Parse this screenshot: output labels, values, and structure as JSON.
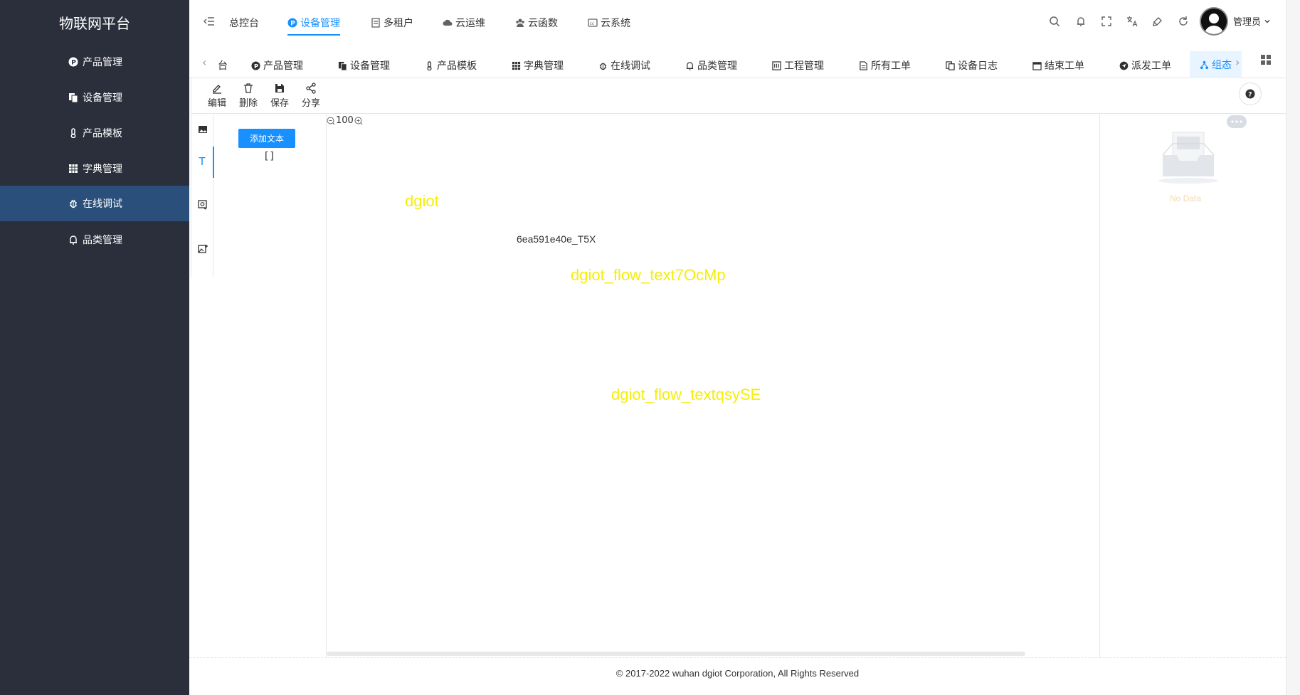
{
  "app": {
    "title": "物联网平台"
  },
  "sidebar": {
    "items": [
      {
        "label": "产品管理",
        "icon": "p-circle-icon"
      },
      {
        "label": "设备管理",
        "icon": "copy-icon"
      },
      {
        "label": "产品模板",
        "icon": "thermometer-icon"
      },
      {
        "label": "字典管理",
        "icon": "grid-icon"
      },
      {
        "label": "在线调试",
        "icon": "bug-icon",
        "active": true
      },
      {
        "label": "品类管理",
        "icon": "bell-icon"
      }
    ]
  },
  "topnav": {
    "items": [
      {
        "label": "总控台"
      },
      {
        "label": "设备管理",
        "active": true
      },
      {
        "label": "多租户"
      },
      {
        "label": "云运维"
      },
      {
        "label": "云函数"
      },
      {
        "label": "云系统"
      }
    ],
    "user_label": "管理员"
  },
  "tags": {
    "items": [
      {
        "label": "台"
      },
      {
        "label": "产品管理"
      },
      {
        "label": "设备管理"
      },
      {
        "label": "产品模板"
      },
      {
        "label": "字典管理"
      },
      {
        "label": "在线调试"
      },
      {
        "label": "品类管理"
      },
      {
        "label": "工程管理"
      },
      {
        "label": "所有工单"
      },
      {
        "label": "设备日志"
      },
      {
        "label": "结束工单"
      },
      {
        "label": "派发工单"
      },
      {
        "label": "组态",
        "active": true
      }
    ]
  },
  "toolbar": {
    "edit_label": "编辑",
    "delete_label": "删除",
    "save_label": "保存",
    "share_label": "分享"
  },
  "component_panel": {
    "add_text_label": "添加文本",
    "list_value": "[]"
  },
  "canvas": {
    "zoom_level": "100",
    "texts": [
      {
        "value": "dgiot",
        "style": "yellow"
      },
      {
        "value": "6ea591e40e_T5X",
        "style": "plain"
      },
      {
        "value": "dgiot_flow_text7OcMp",
        "style": "yellow"
      },
      {
        "value": "dgiot_flow_textqsySE",
        "style": "yellow"
      }
    ],
    "text_color": "#f5ee0a"
  },
  "right_panel": {
    "empty_text": "No Data"
  },
  "footer": {
    "copyright": "© 2017-2022 wuhan dgiot Corporation, All Rights Reserved"
  },
  "colors": {
    "sidebar_bg": "#2a2f3b",
    "sidebar_active": "#2a4f7a",
    "accent": "#1890ff"
  }
}
